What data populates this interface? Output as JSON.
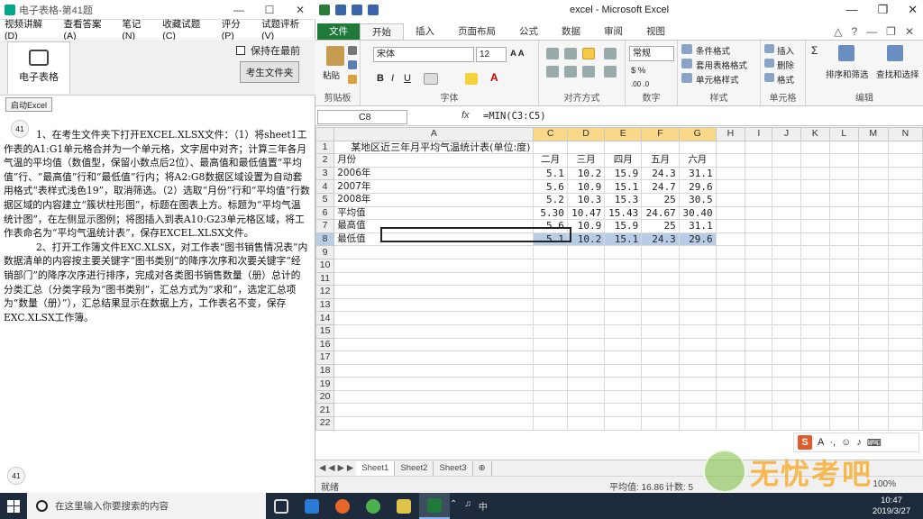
{
  "left_window": {
    "title": "电子表格-第41题",
    "window_controls": [
      "—",
      "☐",
      "✕"
    ],
    "menu": [
      "视频讲解(D)",
      "查看答案(A)",
      "笔记(N)",
      "收藏试题(C)",
      "评分(P)",
      "试题评析(V)"
    ],
    "tab_label": "电子表格",
    "keep_top_label": "保持在最前",
    "exam_folder_button": "考生文件夹",
    "start_button": "启动Excel",
    "question_number": "41",
    "question_text": [
      "1、在考生文件夹下打开EXCEL.XLSX文件：（1）将sheet1工作表的A1:G1单元格合并为一个单元格，文字居中对齐；计算三年各月气温的平均值（数值型，保留小数点后2位）、最高值和最低值置“平均值”行、“最高值”行和“最低值”行内；将A2:G8数据区域设置为自动套用格式“表样式浅色19”，取消筛选。（2）选取“月份”行和“平均值”行数据区域的内容建立“簇状柱形图”，标题在图表上方。标题为“平均气温统计图”，在左侧显示图例；将图插入到表A10:G23单元格区域，将工作表命名为“平均气温统计表”，保存EXCEL.XLSX文件。",
      "2、打开工作簿文件EXC.XLSX，对工作表“图书销售情况表”内数据清单的内容按主要关键字“图书类别”的降序次序和次要关键字“经销部门”的降序次序进行排序，完成对各类图书销售数量（册）总计的分类汇总（分类字段为“图书类别”，汇总方式为“求和”，选定汇总项为“数量（册）”），汇总结果显示在数据上方，工作表名不变，保存EXC.XLSX工作簿。"
    ]
  },
  "excel": {
    "title": "excel - Microsoft Excel",
    "tabs": [
      "文件",
      "开始",
      "插入",
      "页面布局",
      "公式",
      "数据",
      "审阅",
      "视图"
    ],
    "active_tab": "开始",
    "ribbon": {
      "groups": [
        "剪贴板",
        "字体",
        "对齐方式",
        "数字",
        "样式",
        "单元格",
        "编辑"
      ],
      "paste": "粘贴",
      "font_name": "宋体",
      "font_size": "12",
      "number_format": "常规",
      "cond_format": "条件格式",
      "table_format": "套用表格格式",
      "cell_style": "单元格样式",
      "insert": "插入",
      "delete": "删除",
      "format": "格式",
      "sort_filter": "排序和筛选",
      "find_select": "查找和选择"
    },
    "name_box": "C8",
    "fx": "fx",
    "formula": "=MIN(C3:C5)",
    "columns": [
      "A",
      "C",
      "D",
      "E",
      "F",
      "G",
      "H",
      "I",
      "J",
      "K",
      "L",
      "M",
      "N"
    ],
    "title_cell": "某地区近三年月平均气温统计表(单位:度)",
    "header_row": [
      "月份",
      "二月",
      "三月",
      "四月",
      "五月",
      "六月"
    ],
    "data_rows": [
      [
        "2006年",
        "5.1",
        "10.2",
        "15.9",
        "24.3",
        "31.1"
      ],
      [
        "2007年",
        "5.6",
        "10.9",
        "15.1",
        "24.7",
        "29.6"
      ],
      [
        "2008年",
        "5.2",
        "10.3",
        "15.3",
        "25",
        "30.5"
      ],
      [
        "平均值",
        "5.30",
        "10.47",
        "15.43",
        "24.67",
        "30.40"
      ],
      [
        "最高值",
        "5.6",
        "10.9",
        "15.9",
        "25",
        "31.1"
      ],
      [
        "最低值",
        "5.1",
        "10.2",
        "15.1",
        "24.3",
        "29.6"
      ]
    ],
    "sheets": [
      "Sheet1",
      "Sheet2",
      "Sheet3"
    ],
    "status": {
      "ready": "就绪",
      "average": "平均值: 16.86",
      "count": "计数: 5",
      "zoom": "100%"
    }
  },
  "watermark": "无忧考吧",
  "taskbar": {
    "search_placeholder": "在这里输入你要搜索的内容",
    "time": "10:47",
    "date": "2019/3/27"
  }
}
